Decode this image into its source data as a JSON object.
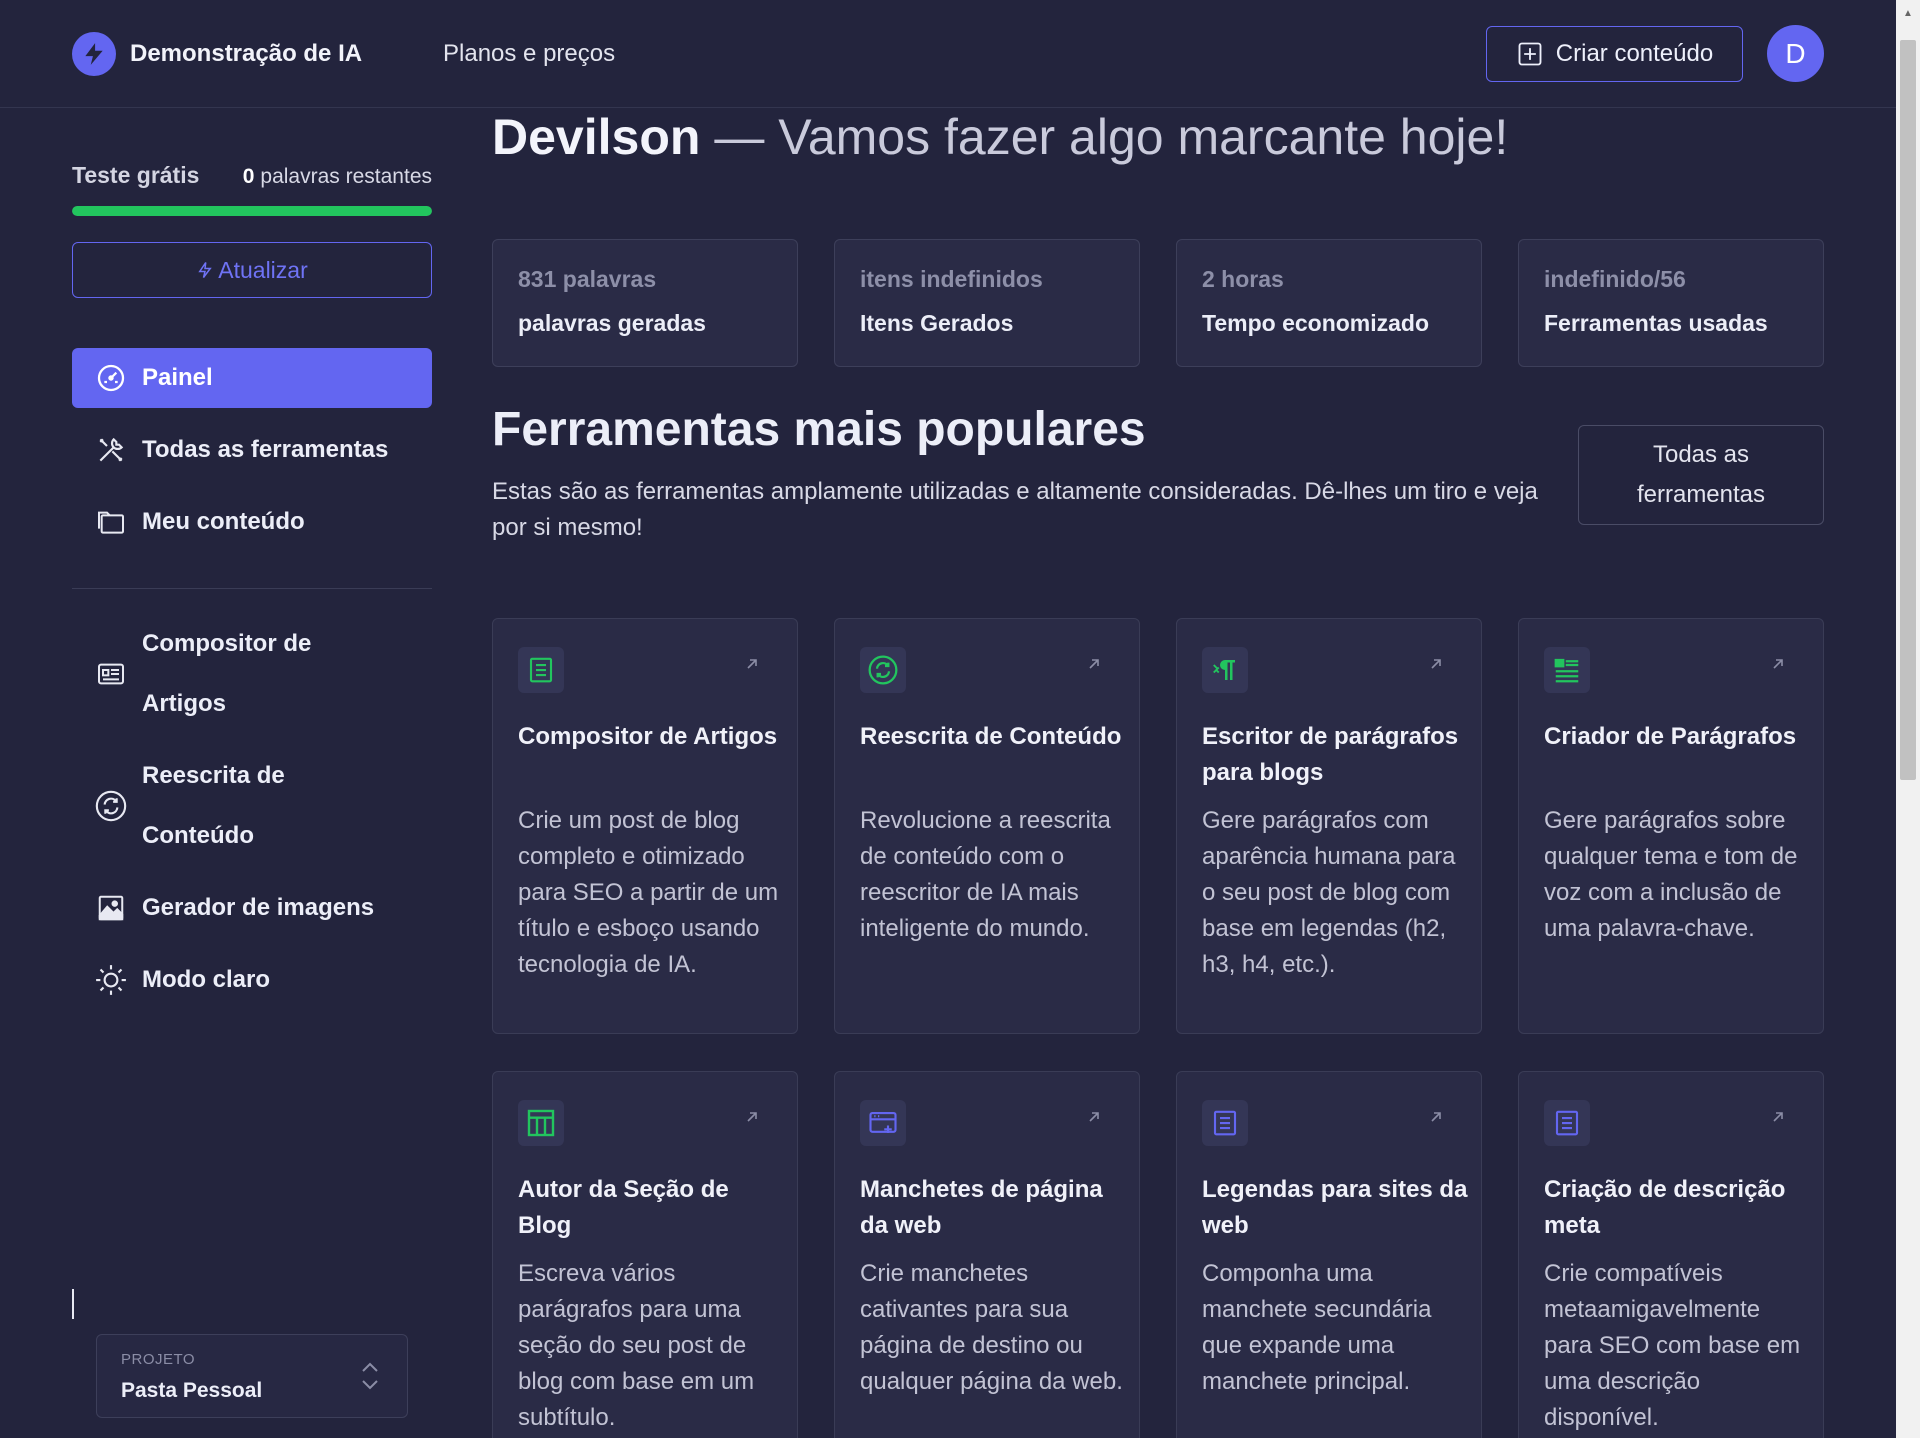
{
  "header": {
    "brand": "Demonstração de IA",
    "nav_plans": "Planos e preços",
    "create_button": "Criar conteúdo",
    "avatar_initial": "D"
  },
  "sidebar": {
    "trial_label": "Teste grátis",
    "words_count": "0",
    "words_suffix": "palavras restantes",
    "trial_progress": 1.0,
    "upgrade_button": "Atualizar",
    "items": [
      {
        "label": "Painel",
        "icon": "dashboard-icon",
        "active": true
      },
      {
        "label": "Todas as ferramentas",
        "icon": "tools-icon"
      },
      {
        "label": "Meu conteúdo",
        "icon": "folder-icon"
      },
      {
        "label": "Compositor de Artigos",
        "icon": "article-icon"
      },
      {
        "label": "Reescrita de Conteúdo",
        "icon": "rewrite-icon"
      },
      {
        "label": "Gerador de imagens",
        "icon": "image-icon"
      },
      {
        "label": "Modo claro",
        "icon": "sun-icon"
      }
    ],
    "project_label": "PROJETO",
    "project_name": "Pasta Pessoal"
  },
  "main": {
    "greeting_name": "Devilson",
    "greeting_rest": "— Vamos fazer algo marcante hoje!",
    "stats": [
      {
        "value": "831 palavras",
        "label": "palavras geradas"
      },
      {
        "value": "itens indefinidos",
        "label": "Itens Gerados"
      },
      {
        "value": "2 horas",
        "label": "Tempo economizado"
      },
      {
        "value": "indefinido/56",
        "label": "Ferramentas usadas"
      }
    ],
    "section_title": "Ferramentas mais populares",
    "section_desc": "Estas são as ferramentas amplamente utilizadas e altamente consideradas. Dê-lhes um tiro e veja por si mesmo!",
    "all_tools_button": "Todas as ferramentas",
    "cards": [
      {
        "title": "Compositor de Artigos",
        "desc": "Crie um post de blog completo e otimizado para SEO a partir de um título e esboço usando tecnologia de IA.",
        "icon": "article-icon",
        "color": "#22c55e"
      },
      {
        "title": "Reescrita de Conteúdo",
        "desc": "Revolucione a reescrita de conteúdo com o reescritor de IA mais inteligente do mundo.",
        "icon": "rewrite-icon",
        "color": "#22c55e"
      },
      {
        "title": "Escritor de parágrafos para blogs",
        "desc": "Gere parágrafos com aparência humana para o seu post de blog com base em legendas (h2, h3, h4, etc.).",
        "icon": "paragraph-icon",
        "color": "#22c55e"
      },
      {
        "title": "Criador de Parágrafos",
        "desc": "Gere parágrafos sobre qualquer tema e tom de voz com a inclusão de uma palavra-chave.",
        "icon": "list-icon",
        "color": "#22c55e"
      },
      {
        "title": "Autor da Seção de Blog",
        "desc": "Escreva vários parágrafos para uma seção do seu post de blog com base em um subtítulo.",
        "icon": "table-icon",
        "color": "#22c55e"
      },
      {
        "title": "Manchetes de página da web",
        "desc": "Crie manchetes cativantes para sua página de destino ou qualquer página da web.",
        "icon": "browser-icon",
        "color": "#6366f1"
      },
      {
        "title": "Legendas para sites da web",
        "desc": "Componha uma manchete secundária que expande uma manchete principal.",
        "icon": "document-icon",
        "color": "#6366f1"
      },
      {
        "title": "Criação de descrição meta",
        "desc": "Crie compatíveis metaamigavelmente para SEO com base em uma descrição disponível.",
        "icon": "document-icon",
        "color": "#6366f1"
      }
    ]
  }
}
